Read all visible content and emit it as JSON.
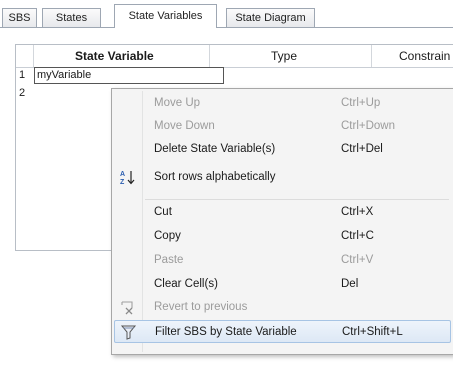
{
  "tabs": [
    {
      "label": "SBS"
    },
    {
      "label": "States"
    },
    {
      "label": "State Variables"
    },
    {
      "label": "State Diagram"
    }
  ],
  "grid": {
    "columns": [
      "State Variable",
      "Type",
      "Constrain"
    ],
    "rows": [
      {
        "num": "1",
        "value": "myVariable"
      },
      {
        "num": "2",
        "value": ""
      }
    ]
  },
  "context_menu": {
    "items": [
      {
        "label": "Move Up",
        "shortcut": "Ctrl+Up",
        "disabled": true
      },
      {
        "label": "Move Down",
        "shortcut": "Ctrl+Down",
        "disabled": true
      },
      {
        "label": "Delete State Variable(s)",
        "shortcut": "Ctrl+Del",
        "disabled": false
      },
      {
        "label": "Sort rows alphabetically",
        "shortcut": "",
        "icon": "sort-az-icon",
        "disabled": false
      },
      {
        "label": "Cut",
        "shortcut": "Ctrl+X",
        "disabled": false
      },
      {
        "label": "Copy",
        "shortcut": "Ctrl+C",
        "disabled": false
      },
      {
        "label": "Paste",
        "shortcut": "Ctrl+V",
        "disabled": true
      },
      {
        "label": "Clear Cell(s)",
        "shortcut": "Del",
        "disabled": false
      },
      {
        "label": "Revert to previous",
        "shortcut": "",
        "icon": "revert-icon",
        "disabled": true
      },
      {
        "label": "Filter SBS by State Variable",
        "shortcut": "Ctrl+Shift+L",
        "icon": "filter-icon",
        "disabled": false,
        "highlighted": true
      }
    ]
  }
}
